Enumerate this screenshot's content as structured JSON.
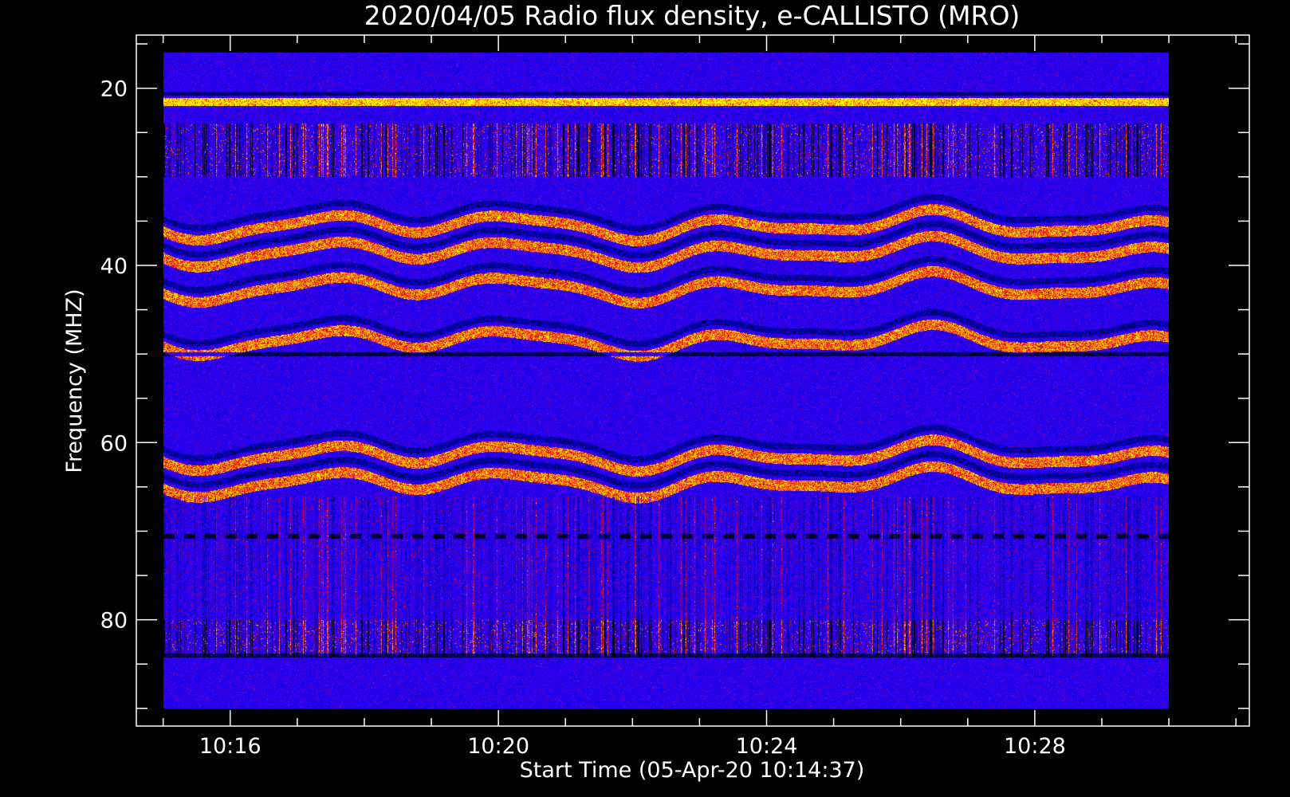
{
  "chart_data": {
    "type": "heatmap",
    "title": "2020/04/05  Radio flux density, e-CALLISTO (MRO)",
    "xlabel": "Start Time (05-Apr-20 10:14:37)",
    "ylabel": "Frequency (MHZ)",
    "x_ticks": [
      {
        "minute": 16,
        "label": "10:16"
      },
      {
        "minute": 20,
        "label": "10:20"
      },
      {
        "minute": 24,
        "label": "10:24"
      },
      {
        "minute": 28,
        "label": "10:28"
      }
    ],
    "y_ticks": [
      {
        "value": 20,
        "label": "20"
      },
      {
        "value": 40,
        "label": "40"
      },
      {
        "value": 60,
        "label": "60"
      },
      {
        "value": 80,
        "label": "80"
      }
    ],
    "xlim_minutes": [
      14.6,
      31.2
    ],
    "ylim_mhz": [
      14,
      92
    ],
    "data_extent": {
      "time_minutes": [
        15.0,
        30.0
      ],
      "freq_mhz": [
        16,
        90
      ]
    },
    "y_axis_inverted": true,
    "colormap": [
      "#000000",
      "#0000ff",
      "#ff0000",
      "#ffff00"
    ],
    "features": [
      {
        "kind": "persistent-band",
        "freq_mhz": 21.5,
        "intensity": "high"
      },
      {
        "kind": "banded-interference",
        "freq_range_mhz": [
          24,
          30
        ]
      },
      {
        "kind": "wavy-band",
        "freq_mhz": 35.5
      },
      {
        "kind": "wavy-band",
        "freq_mhz": 38.5
      },
      {
        "kind": "wavy-band",
        "freq_mhz": 42.5
      },
      {
        "kind": "wavy-band",
        "freq_mhz": 48.5
      },
      {
        "kind": "wavy-band",
        "freq_mhz": 61.5
      },
      {
        "kind": "wavy-band",
        "freq_mhz": 64.5
      },
      {
        "kind": "dark-line",
        "freq_mhz": 50.0
      },
      {
        "kind": "dashed-dark-line",
        "freq_mhz": 70.5
      },
      {
        "kind": "banded-interference",
        "freq_range_mhz": [
          80,
          84
        ]
      },
      {
        "kind": "dark-line",
        "freq_mhz": 84.0
      }
    ]
  }
}
